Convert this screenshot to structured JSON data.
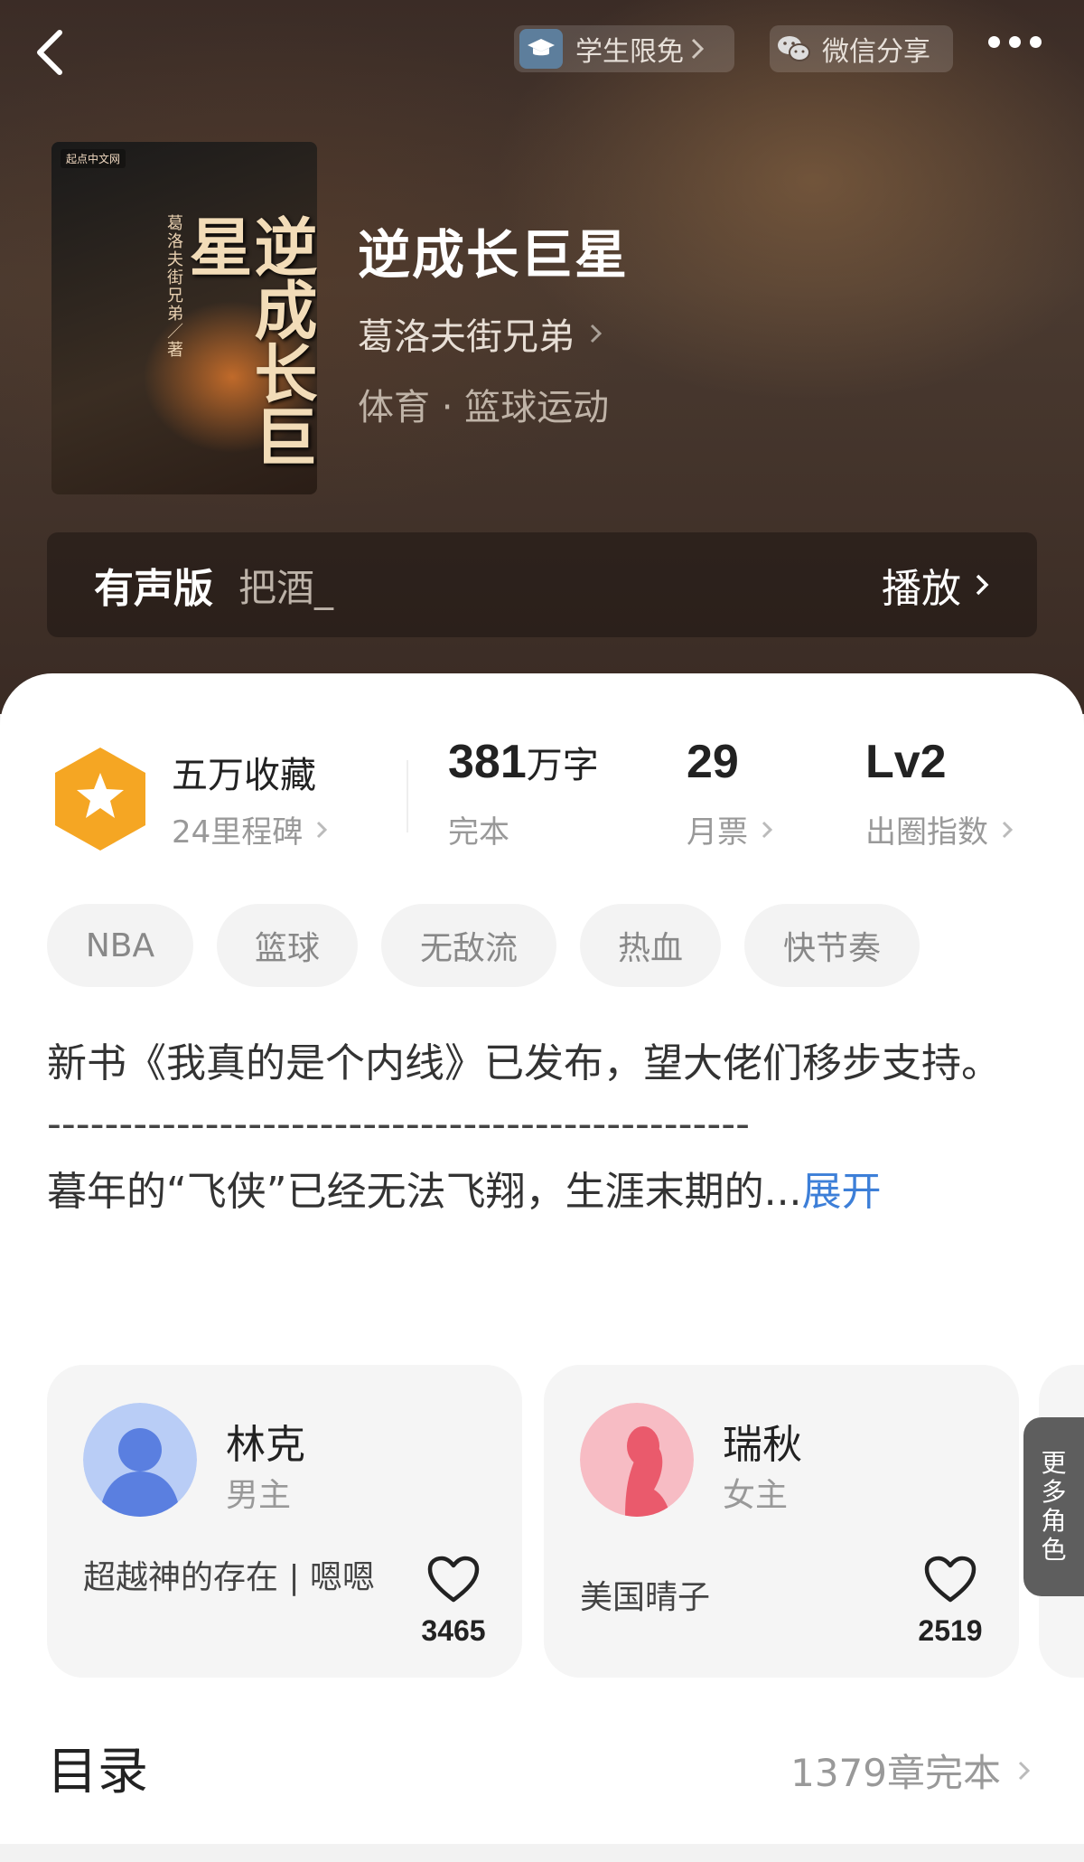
{
  "header": {
    "student_label": "学生限免",
    "wechat_label": "微信分享"
  },
  "book": {
    "title": "逆成长巨星",
    "cover_title": "逆成长巨星",
    "cover_author": "葛洛夫街兄弟／著",
    "cover_badge": "起点中文网",
    "author": "葛洛夫街兄弟",
    "genre": "体育 · 篮球运动"
  },
  "audio": {
    "label": "有声版",
    "narrator": "把酒_",
    "play_label": "播放"
  },
  "stats": {
    "collect_title": "五万收藏",
    "collect_sub": "24里程碑",
    "words_num": "381",
    "words_unit": "万字",
    "status": "完本",
    "votes_num": "29",
    "votes_label": "月票",
    "level": "Lv2",
    "level_label": "出圈指数"
  },
  "tags": [
    "NBA",
    "篮球",
    "无敌流",
    "热血",
    "快节奏"
  ],
  "description": {
    "line1": "新书《我真的是个内线》已发布，望大佬们移步支持。",
    "separator": "-------------------------------------------------",
    "line2": "暮年的“飞侠”已经无法飞翔，生涯末期的...",
    "expand": "展开"
  },
  "characters": [
    {
      "name": "林克",
      "role": "男主",
      "desc": "超越神的存在 | 嗯嗯",
      "likes": "3465",
      "color": "#7a9ce8"
    },
    {
      "name": "瑞秋",
      "role": "女主",
      "desc": "美国晴子",
      "likes": "2519",
      "color": "#ee6b7a"
    }
  ],
  "more_roles": "更多角色",
  "toc": {
    "title": "目录",
    "count": "1379章完本"
  },
  "colors": {
    "accent_blue": "#3d7fd8",
    "badge_orange": "#f5a623"
  }
}
